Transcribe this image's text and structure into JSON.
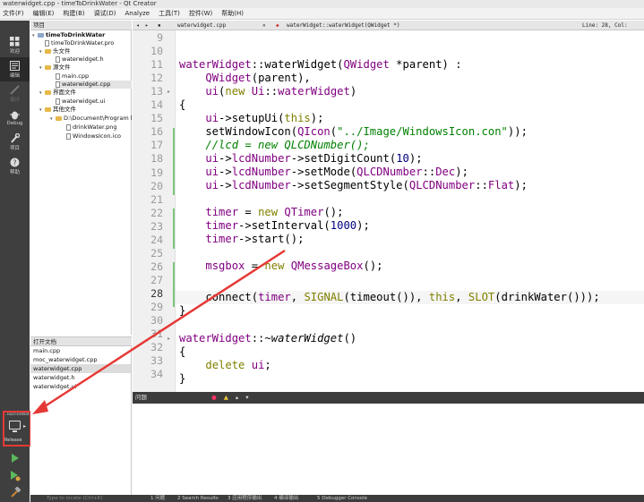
{
  "window": {
    "title": "waterwidget.cpp - timeToDrinkWater - Qt Creator"
  },
  "menu": [
    "文件(F)",
    "编辑(E)",
    "构建(B)",
    "调试(D)",
    "Analyze",
    "工具(T)",
    "控件(W)",
    "帮助(H)"
  ],
  "modes": [
    {
      "label": "欢迎",
      "icon": "welcome-grid-icon"
    },
    {
      "label": "编辑",
      "icon": "edit-icon"
    },
    {
      "label": "设计",
      "icon": "design-icon"
    },
    {
      "label": "Debug",
      "icon": "debug-icon"
    },
    {
      "label": "项目",
      "icon": "project-wrench-icon"
    },
    {
      "label": "帮助",
      "icon": "help-icon"
    }
  ],
  "kit": {
    "top_label": "...ToDrinkWater",
    "build": "Release"
  },
  "project_panel": {
    "title": "项目"
  },
  "tree": [
    {
      "label": "timeToDrinkWater",
      "kind": "project",
      "indent": 0
    },
    {
      "label": "timeToDrinkWater.pro",
      "kind": "file",
      "indent": 1
    },
    {
      "label": "头文件",
      "kind": "folder",
      "indent": 1
    },
    {
      "label": "waterwidget.h",
      "kind": "file",
      "indent": 2
    },
    {
      "label": "源文件",
      "kind": "folder",
      "indent": 1
    },
    {
      "label": "main.cpp",
      "kind": "file",
      "indent": 2
    },
    {
      "label": "waterwidget.cpp",
      "kind": "file",
      "indent": 2
    },
    {
      "label": "界面文件",
      "kind": "folder",
      "indent": 1
    },
    {
      "label": "waterwidget.ui",
      "kind": "file",
      "indent": 2
    },
    {
      "label": "其他文件",
      "kind": "folder",
      "indent": 1
    },
    {
      "label": "D:\\Document\\Program l",
      "kind": "folder",
      "indent": 2
    },
    {
      "label": "drinkWater.png",
      "kind": "file",
      "indent": 3
    },
    {
      "label": "WindowsIcon.ico",
      "kind": "file",
      "indent": 3
    }
  ],
  "open_docs": {
    "title": "打开文档",
    "items": [
      "main.cpp",
      "moc_waterwidget.cpp",
      "waterwidget.cpp",
      "waterwidget.h",
      "waterwidget.ui"
    ]
  },
  "editor": {
    "file_tab": "waterwidget.cpp",
    "symbol": "waterWidget::waterWidget(QWidget *)",
    "position": "Line: 28, Col:",
    "current_line": 28,
    "line_numbers": [
      9,
      10,
      11,
      12,
      13,
      14,
      15,
      16,
      17,
      18,
      19,
      20,
      21,
      22,
      23,
      24,
      25,
      26,
      27,
      28,
      29,
      30,
      31,
      32,
      33,
      34
    ]
  },
  "issues": {
    "title": "问题"
  },
  "status": {
    "locator_placeholder": "Type to locate (Ctrl+K)",
    "panes": [
      "1 问题",
      "2 Search Results",
      "3 应用程序输出",
      "4 编译输出",
      "5 Debugger Console"
    ]
  },
  "colors": {
    "modebar": "#3f3f3f",
    "keyword": "#808000",
    "type": "#800080",
    "string": "#008000",
    "number": "#000080",
    "annotation": "#e53935"
  }
}
